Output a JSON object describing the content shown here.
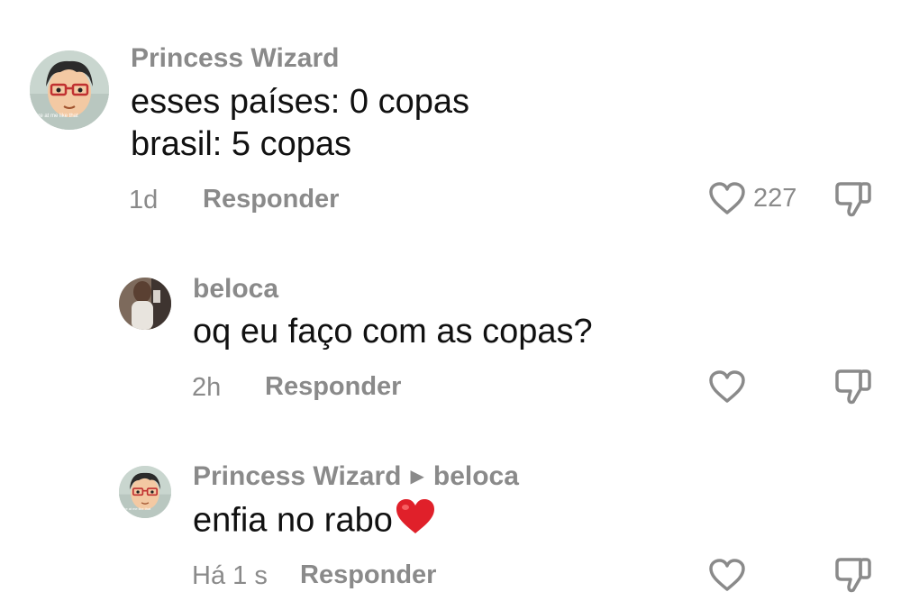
{
  "comments": [
    {
      "author": "Princess Wizard",
      "lines": [
        "esses países: 0 copas",
        "brasil: 5 copas"
      ],
      "avatar_caption": "ere at me like that",
      "time": "1d",
      "reply_label": "Responder",
      "likes": "227"
    },
    {
      "author": "beloca",
      "text": "oq eu faço com as copas?",
      "time": "2h",
      "reply_label": "Responder"
    },
    {
      "author": "Princess Wizard",
      "reply_to": "beloca",
      "text": "enfia no rabo",
      "avatar_caption": "ere at me like that",
      "time": "Há 1 s",
      "reply_label": "Responder"
    }
  ],
  "icons": {
    "like": "heart-outline-icon",
    "dislike": "thumbs-down-icon",
    "emoji": "red-heart-emoji",
    "reply_arrow": "triangle-right-icon"
  },
  "colors": {
    "secondary_text": "#8a8a8a",
    "primary_text": "#111111",
    "emoji_heart": "#e0202a"
  }
}
